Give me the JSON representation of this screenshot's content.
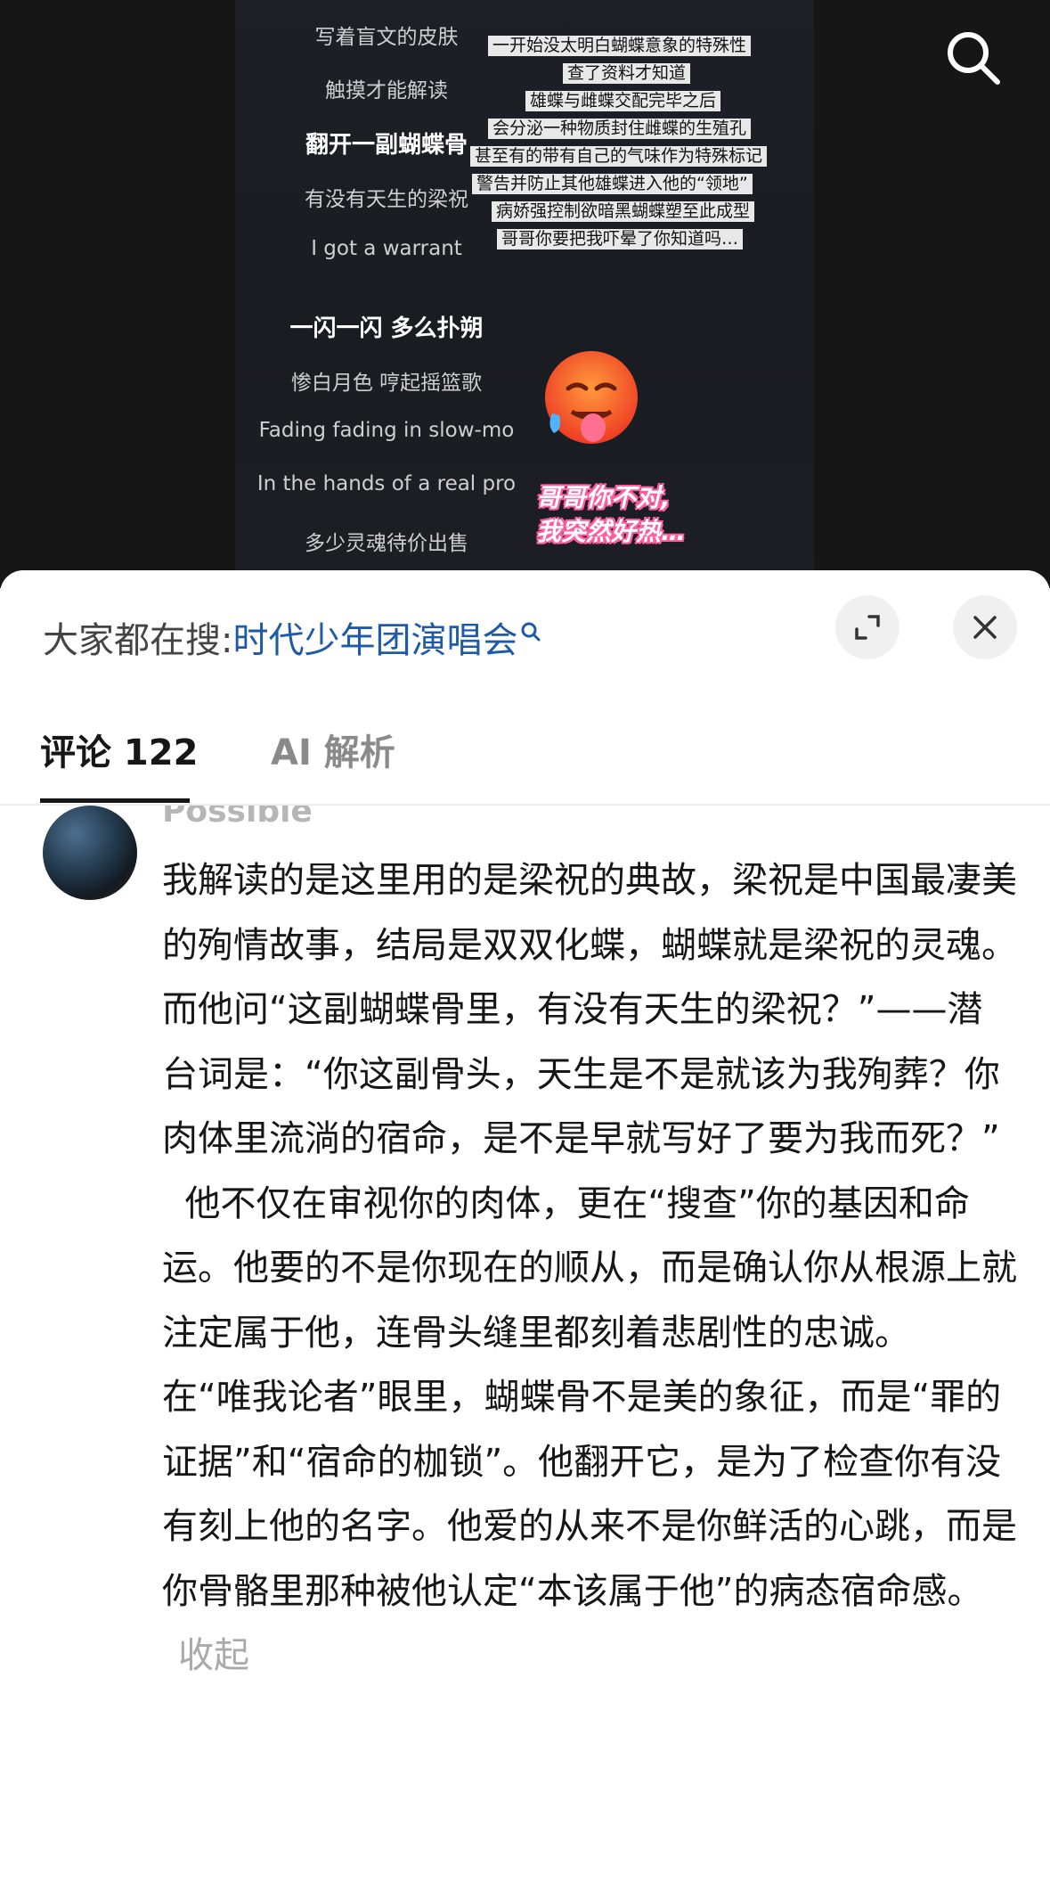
{
  "video": {
    "lyrics": [
      "写着盲文的皮肤",
      "触摸才能解读",
      "翻开一副蝴蝶骨",
      "有没有天生的梁祝",
      "I got a warrant",
      "一闪一闪 多么扑朔",
      "惨白月色 哼起摇篮歌",
      "Fading fading in slow-mo",
      "In the hands of a real pro",
      "多少灵魂待价出售"
    ],
    "captions": [
      "一开始没太明白蝴蝶意象的特殊性",
      "查了资料才知道",
      "雄蝶与雌蝶交配完毕之后",
      "会分泌一种物质封住雌蝶的生殖孔",
      "甚至有的带有自己的气味作为特殊标记",
      "警告并防止其他雄蝶进入他的“领地”",
      "病娇强控制欲暗黑蝴蝶塑至此成型",
      "哥哥你要把我吓晕了你知道吗…"
    ],
    "sticker_line1": "哥哥你不对,",
    "sticker_line2": "我突然好热…",
    "emoji_icon": "hot-face-emoji"
  },
  "sheet": {
    "search_prefix": "大家都在搜:",
    "search_term": "时代少年团演唱会",
    "expand_icon": "expand-icon",
    "close_icon": "close-icon"
  },
  "tabs": {
    "comments": "评论 122",
    "ai": "AI 解析"
  },
  "comment": {
    "username": "Possible",
    "paragraphs": [
      "我解读的是这里用的是梁祝的典故，梁祝是中国最凄美的殉情故事，结局是双双化蝶，蝴蝶就是梁祝的灵魂。",
      "而他问“这副蝴蝶骨里，有没有天生的梁祝？”——潜台词是：“你这副骨头，天生是不是就该为我殉葬？你肉体里流淌的宿命，是不是早就写好了要为我而死？”",
      "  他不仅在审视你的肉体，更在“搜查”你的基因和命运。他要的不是你现在的顺从，而是确认你从根源上就注定属于他，连骨头缝里都刻着悲剧性的忠诚。",
      "在“唯我论者”眼里，蝴蝶骨不是美的象征，而是“罪的证据”和“宿命的枷锁”。他翻开它，是为了检查你有没有刻上他的名字。他爱的从来不是你鲜活的心跳，而是你骨骼里那种被他认定“本该属于他”的病态宿命感。"
    ],
    "collapse": "收起"
  },
  "colors": {
    "accent_link": "#1f5aa6",
    "text_primary": "#161616",
    "text_muted": "#a9a9a9"
  }
}
